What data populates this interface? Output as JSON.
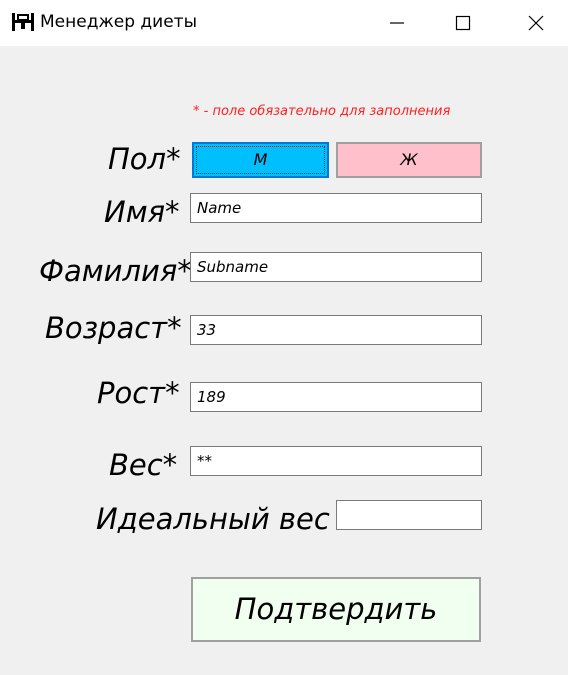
{
  "window": {
    "title": "Менеджер диеты",
    "app_icon": "scale-icon"
  },
  "form": {
    "required_note": "* - поле обязательно для заполнения",
    "gender": {
      "label": "Пол*",
      "male_label": "М",
      "female_label": "Ж",
      "male_color": "#00bfff",
      "female_color": "#ffc0cb",
      "selected": "М"
    },
    "name": {
      "label": "Имя*",
      "value": "Name"
    },
    "surname": {
      "label": "Фамилия*",
      "value": "Subname"
    },
    "age": {
      "label": "Возраст*",
      "value": "33"
    },
    "height": {
      "label": "Рост*",
      "value": "189"
    },
    "weight": {
      "label": "Вес*",
      "value": "**"
    },
    "ideal_weight": {
      "label": "Идеальный вес",
      "value": ""
    },
    "submit_label": "Подтвердить",
    "submit_color": "#f0fff0"
  }
}
